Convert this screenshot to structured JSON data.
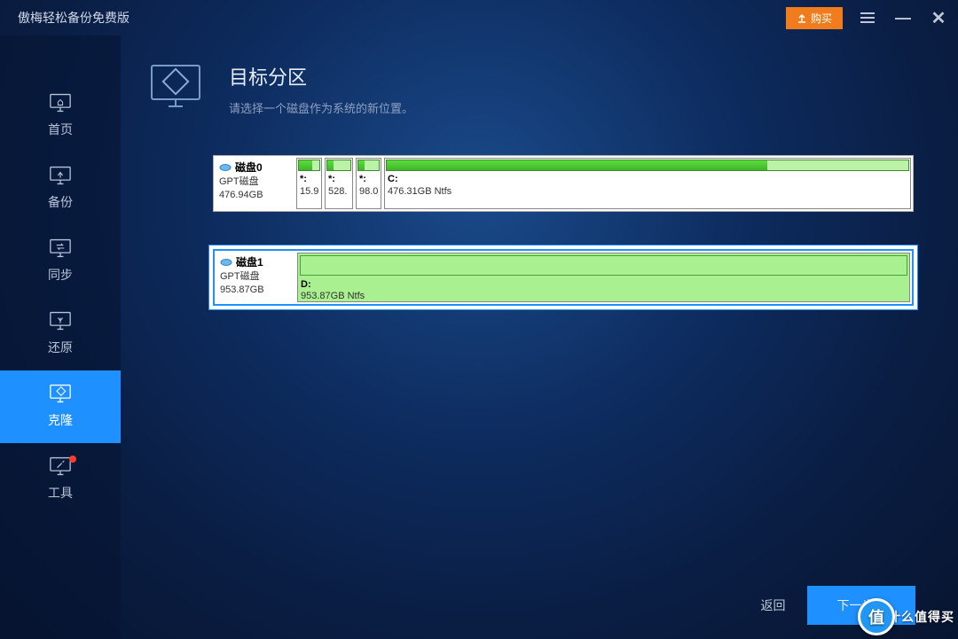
{
  "titlebar": {
    "title": "傲梅轻松备份免费版",
    "buy_label": "购买"
  },
  "sidebar": {
    "items": [
      {
        "label": "首页"
      },
      {
        "label": "备份"
      },
      {
        "label": "同步"
      },
      {
        "label": "还原"
      },
      {
        "label": "克隆"
      },
      {
        "label": "工具"
      }
    ]
  },
  "header": {
    "title": "目标分区",
    "subtitle": "请选择一个磁盘作为系统的新位置。"
  },
  "disks": [
    {
      "name": "磁盘0",
      "type": "GPT磁盘",
      "size": "476.94GB",
      "partitions": [
        {
          "letter": "*:",
          "size_label": "15.9",
          "used_pct": 65
        },
        {
          "letter": "*:",
          "size_label": "528.",
          "used_pct": 25
        },
        {
          "letter": "*:",
          "size_label": "98.0",
          "used_pct": 30
        },
        {
          "letter": "C:",
          "size_label": "476.31GB Ntfs",
          "used_pct": 73
        }
      ]
    },
    {
      "name": "磁盘1",
      "type": "GPT磁盘",
      "size": "953.87GB",
      "partitions": [
        {
          "letter": "D:",
          "size_label": "953.87GB Ntfs",
          "used_pct": 0
        }
      ]
    }
  ],
  "footer": {
    "back": "返回",
    "next": "下一步"
  },
  "watermark": {
    "badge": "值",
    "text": "什么值得买"
  }
}
